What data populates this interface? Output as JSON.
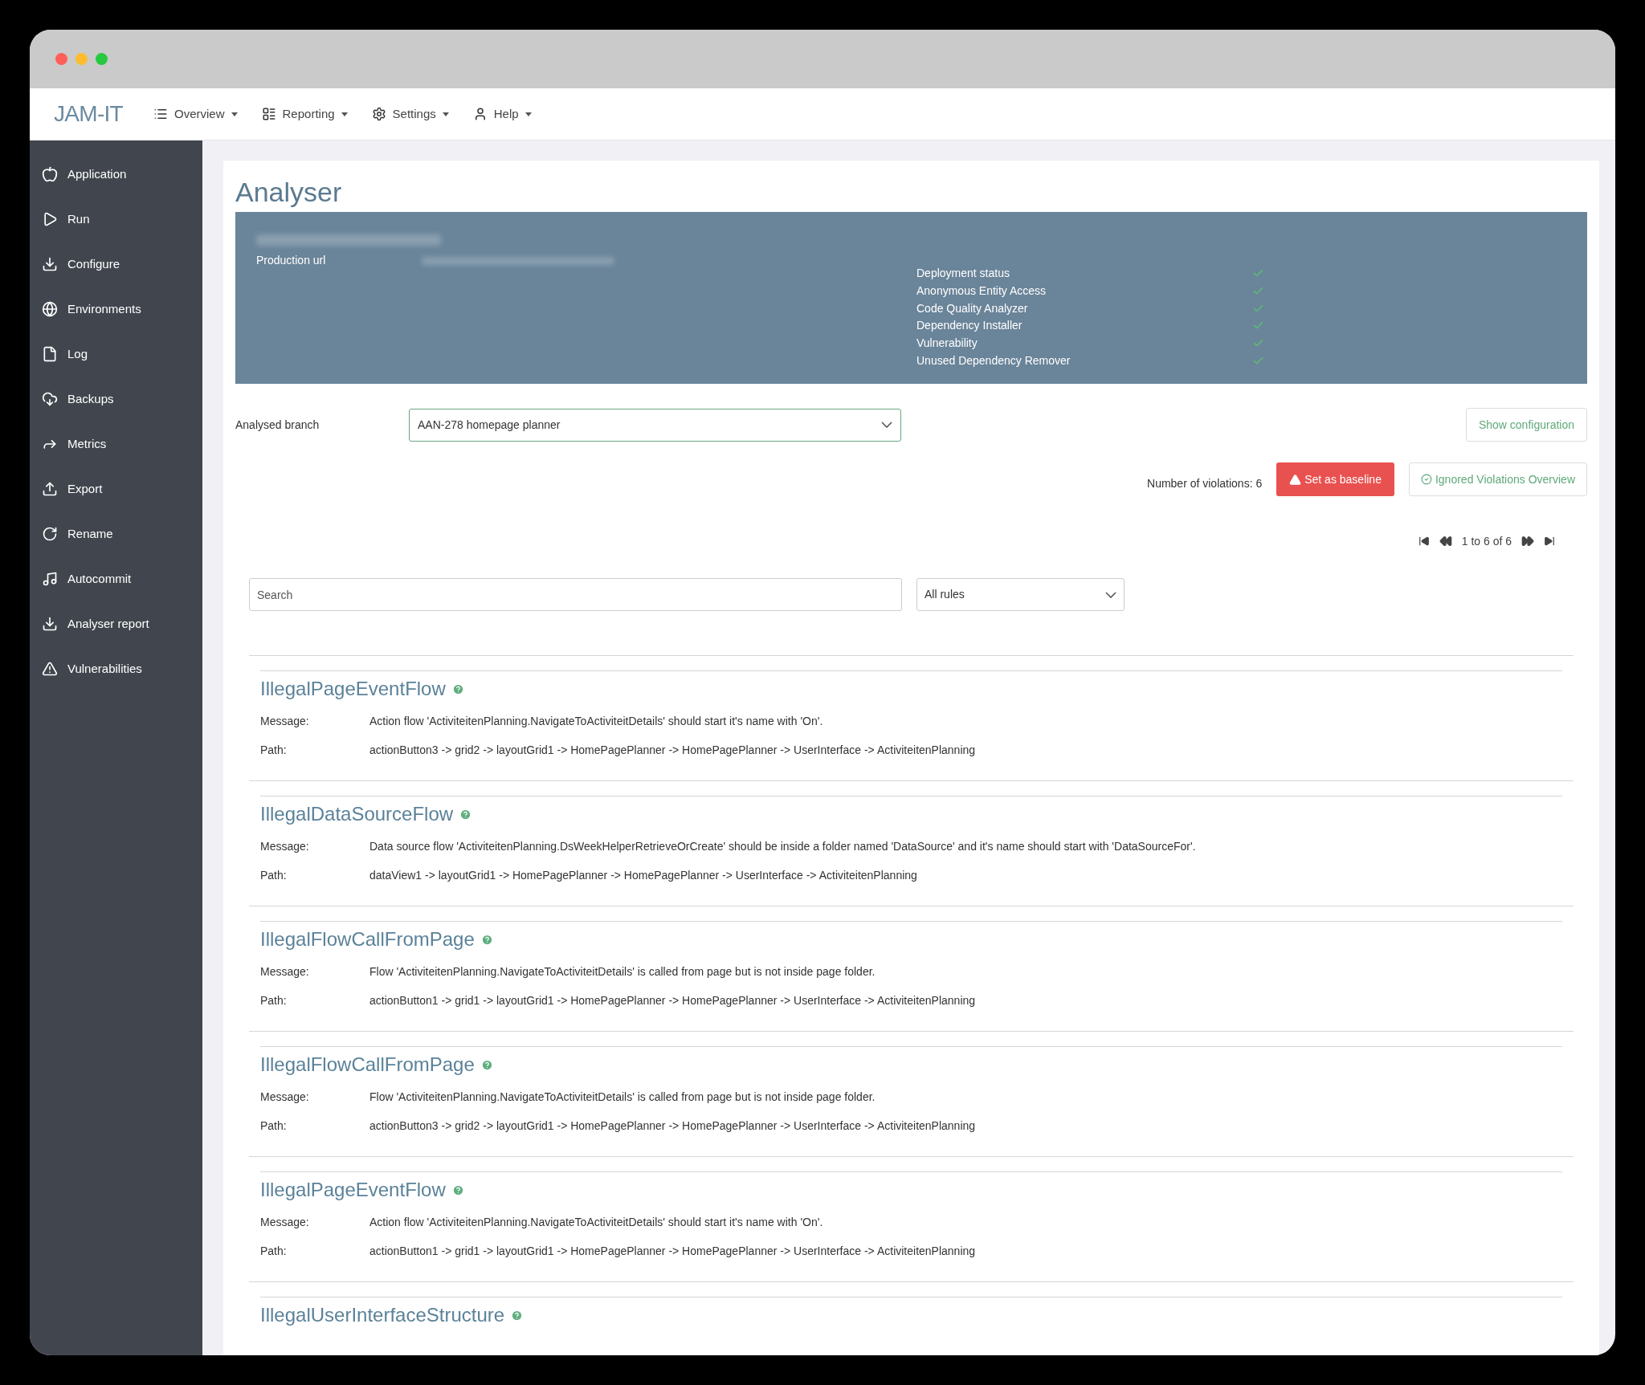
{
  "brand": "JAM-IT",
  "nav": [
    {
      "label": "Overview"
    },
    {
      "label": "Reporting"
    },
    {
      "label": "Settings"
    },
    {
      "label": "Help"
    }
  ],
  "sidebar": {
    "items": [
      {
        "label": "Application"
      },
      {
        "label": "Run"
      },
      {
        "label": "Configure"
      },
      {
        "label": "Environments"
      },
      {
        "label": "Log"
      },
      {
        "label": "Backups"
      },
      {
        "label": "Metrics"
      },
      {
        "label": "Export"
      },
      {
        "label": "Rename"
      },
      {
        "label": "Autocommit"
      },
      {
        "label": "Analyser report"
      },
      {
        "label": "Vulnerabilities"
      }
    ]
  },
  "page_title": "Analyser",
  "info_panel": {
    "production_url_label": "Production url",
    "statuses": [
      {
        "label": "Deployment status",
        "ok": true
      },
      {
        "label": "Anonymous Entity Access",
        "ok": true
      },
      {
        "label": "Code Quality Analyzer",
        "ok": true
      },
      {
        "label": "Dependency Installer",
        "ok": true
      },
      {
        "label": "Vulnerability",
        "ok": true
      },
      {
        "label": "Unused Dependency Remover",
        "ok": true
      }
    ]
  },
  "branch": {
    "label": "Analysed branch",
    "value": "AAN-278 homepage planner"
  },
  "show_configuration": "Show configuration",
  "violations_count": "Number of violations: 6",
  "set_baseline": "Set as baseline",
  "ignored_overview": "Ignored Violations Overview",
  "pagination": "1 to 6 of 6",
  "search": {
    "placeholder": "Search"
  },
  "rule_filter": {
    "value": "All rules"
  },
  "violations": [
    {
      "rule": "IllegalPageEventFlow",
      "message_label": "Message:",
      "message": "Action flow 'ActiviteitenPlanning.NavigateToActiviteitDetails' should start it's name with 'On'.",
      "path_label": "Path:",
      "path": "actionButton3 -> grid2 -> layoutGrid1 -> HomePagePlanner -> HomePagePlanner -> UserInterface -> ActiviteitenPlanning"
    },
    {
      "rule": "IllegalDataSourceFlow",
      "message_label": "Message:",
      "message": "Data source flow 'ActiviteitenPlanning.DsWeekHelperRetrieveOrCreate' should be inside a folder named 'DataSource' and it's name should start with 'DataSourceFor'.",
      "path_label": "Path:",
      "path": "dataView1 -> layoutGrid1 -> HomePagePlanner -> HomePagePlanner -> UserInterface -> ActiviteitenPlanning"
    },
    {
      "rule": "IllegalFlowCallFromPage",
      "message_label": "Message:",
      "message": "Flow 'ActiviteitenPlanning.NavigateToActiviteitDetails' is called from page but is not inside page folder.",
      "path_label": "Path:",
      "path": "actionButton1 -> grid1 -> layoutGrid1 -> HomePagePlanner -> HomePagePlanner -> UserInterface -> ActiviteitenPlanning"
    },
    {
      "rule": "IllegalFlowCallFromPage",
      "message_label": "Message:",
      "message": "Flow 'ActiviteitenPlanning.NavigateToActiviteitDetails' is called from page but is not inside page folder.",
      "path_label": "Path:",
      "path": "actionButton3 -> grid2 -> layoutGrid1 -> HomePagePlanner -> HomePagePlanner -> UserInterface -> ActiviteitenPlanning"
    },
    {
      "rule": "IllegalPageEventFlow",
      "message_label": "Message:",
      "message": "Action flow 'ActiviteitenPlanning.NavigateToActiviteitDetails' should start it's name with 'On'.",
      "path_label": "Path:",
      "path": "actionButton1 -> grid1 -> layoutGrid1 -> HomePagePlanner -> HomePagePlanner -> UserInterface -> ActiviteitenPlanning"
    },
    {
      "rule": "IllegalUserInterfaceStructure"
    }
  ]
}
